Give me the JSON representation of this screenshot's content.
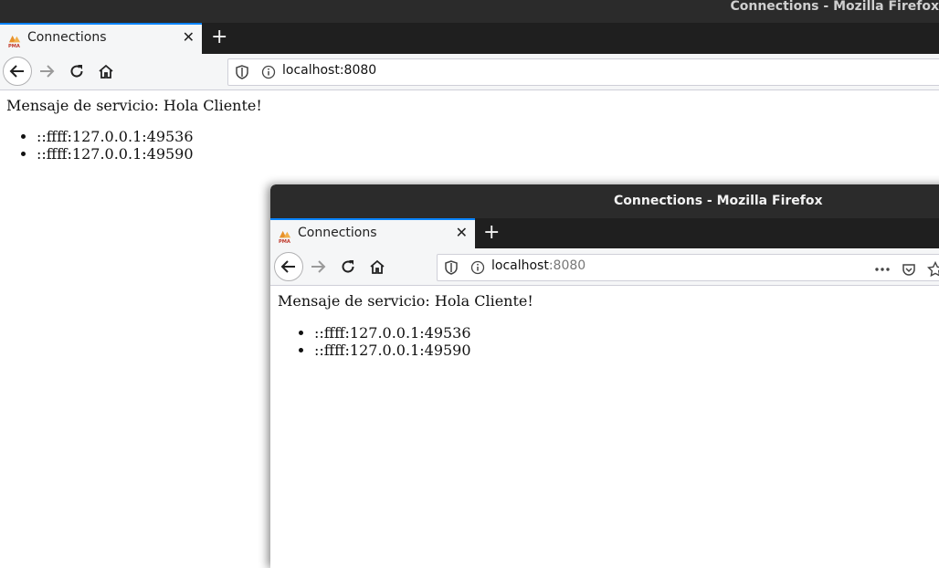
{
  "back_window": {
    "title": "Connections - Mozilla Firefox",
    "tab": {
      "title": "Connections",
      "icon": "pma-favicon"
    },
    "url": "localhost:8080",
    "content": {
      "message": "Mensaje de servicio: Hola Cliente!",
      "connections": [
        "::ffff:127.0.0.1:49536",
        "::ffff:127.0.0.1:49590"
      ]
    }
  },
  "front_window": {
    "title": "Connections - Mozilla Firefox",
    "tab": {
      "title": "Connections",
      "icon": "pma-favicon"
    },
    "url_host": "localhost",
    "url_port": ":8080",
    "content": {
      "message": "Mensaje de servicio: Hola Cliente!",
      "connections": [
        "::ffff:127.0.0.1:49536",
        "::ffff:127.0.0.1:49590"
      ]
    }
  },
  "icons": {
    "back": "arrow-left-icon",
    "forward": "arrow-right-icon",
    "reload": "reload-icon",
    "home": "home-icon",
    "tracking": "shield-icon",
    "site_info": "info-icon",
    "page_actions": "ellipsis-icon",
    "pocket": "pocket-icon",
    "bookmark": "star-icon"
  },
  "colors": {
    "titlebar": "#2b2b2b",
    "tabstrip": "#1f1f1f",
    "tab_accent": "#0a84ff",
    "toolbar": "#f5f6f7"
  }
}
